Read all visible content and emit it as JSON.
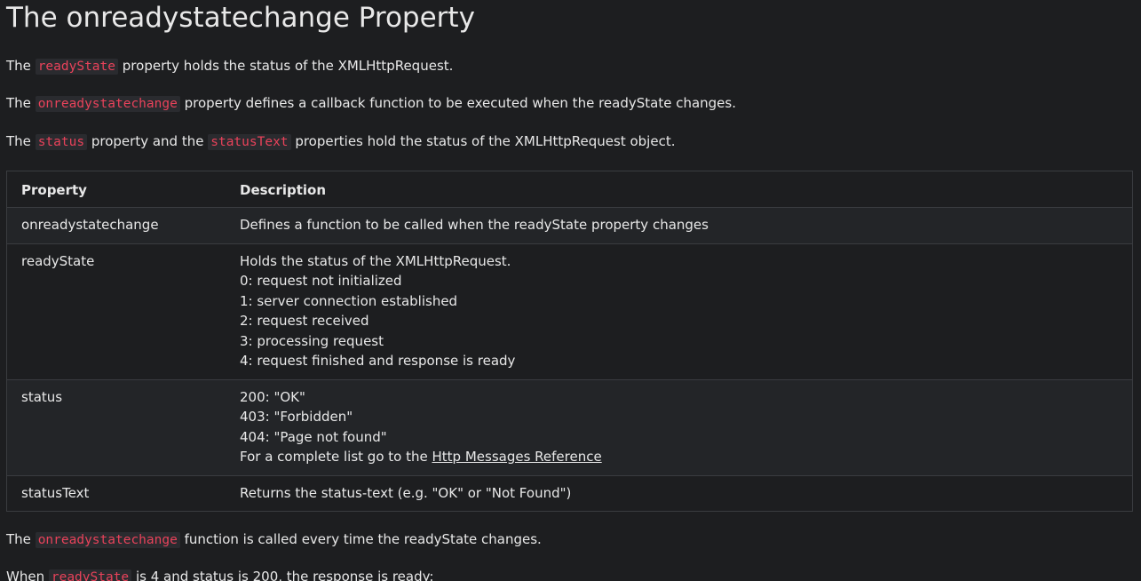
{
  "heading": "The onreadystatechange Property",
  "intro": [
    {
      "before": "The",
      "code": "readyState",
      "after": "property holds the status of the XMLHttpRequest."
    },
    {
      "before": "The",
      "code": "onreadystatechange",
      "after": "property defines a callback function to be executed when the readyState changes."
    },
    {
      "before": "The",
      "code": "status",
      "middle": "property and the",
      "code2": "statusText",
      "after": "properties hold the status of the XMLHttpRequest object."
    }
  ],
  "table": {
    "headers": [
      "Property",
      "Description"
    ],
    "rows": [
      {
        "property": "onreadystatechange",
        "lines": [
          "Defines a function to be called when the readyState property changes"
        ]
      },
      {
        "property": "readyState",
        "lines": [
          "Holds the status of the XMLHttpRequest.",
          "0: request not initialized",
          "1: server connection established",
          "2: request received",
          "3: processing request",
          "4: request finished and response is ready"
        ]
      },
      {
        "property": "status",
        "lines": [
          "200: \"OK\"",
          "403: \"Forbidden\"",
          "404: \"Page not found\""
        ],
        "link_prefix": "For a complete list go to the",
        "link_text": "Http Messages Reference"
      },
      {
        "property": "statusText",
        "lines": [
          "Returns the status-text (e.g. \"OK\" or \"Not Found\")"
        ]
      }
    ]
  },
  "outro": [
    {
      "before": "The",
      "code": "onreadystatechange",
      "after": "function is called every time the readyState changes."
    },
    {
      "before": "When",
      "code": "readyState",
      "after": "is 4 and status is 200, the response is ready:"
    }
  ],
  "colors": {
    "background": "#1d1e20",
    "text": "#e8e8e8",
    "code_text": "#e8425a",
    "code_background": "#2a2b2f",
    "table_border": "#3a3c40",
    "row_alt": "#232528"
  }
}
